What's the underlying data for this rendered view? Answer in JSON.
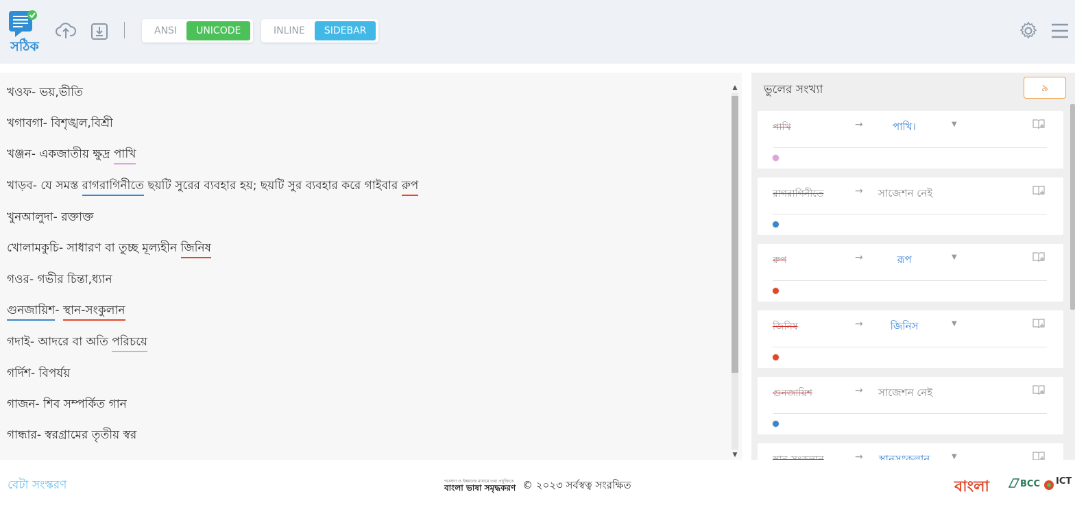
{
  "app": {
    "name": "সঠিক"
  },
  "colors": {
    "accent": "#42b8e6",
    "green": "#4cc15a",
    "error_red": "#e2472a",
    "error_blue": "#3a86c8",
    "error_pink": "#e0a2d8",
    "count_orange": "#e67e22"
  },
  "toolbar": {
    "icons": [
      "upload-cloud-icon",
      "download-icon",
      "settings-icon",
      "hamburger-menu-icon"
    ],
    "encoding": {
      "ansi": "ANSI",
      "unicode": "UNICODE",
      "selected": "UNICODE"
    },
    "view": {
      "inline": "INLINE",
      "sidebar": "SIDEBAR",
      "selected": "SIDEBAR"
    }
  },
  "editor": {
    "lines": [
      [
        "খওফ- ভয়,ভীতি"
      ],
      [
        "খগাবগা- বিশৃঙ্খল,বিশ্রী"
      ],
      [
        "খঞ্জন- একজাতীয় ক্ষুদ্র ",
        "পাখি"
      ],
      [
        "খাড়ব- যে সমস্ত ",
        "রাগরাগিনীতে",
        " ছয়টি সুরের ব্যবহার হয়; ছয়টি সুর ব্যবহার করে গাইবার ",
        "রুপ"
      ],
      [
        "খুনআলুদা- রক্তাক্ত"
      ],
      [
        "খোলামকুচি- সাধারণ বা তুচ্ছ মূল্যহীন ",
        "জিনিষ"
      ],
      [
        "গওর- গভীর চিন্তা,ধ্যান"
      ],
      [
        "গুনজায়িশ",
        "- ",
        "স্থান-সংকুলান"
      ],
      [
        "গদাই- আদরে বা অতি ",
        "পরিচয়ে"
      ],
      [
        "গর্দিশ- বিপর্যয়"
      ],
      [
        "গাজন- শিব সম্পর্কিত গান"
      ],
      [
        "গান্ধার- স্বরগ্রামের তৃতীয় স্বর"
      ]
    ]
  },
  "sidebar": {
    "title": "ভুলের সংখ্যা",
    "error_count": "৯",
    "errors": [
      {
        "original": "পাখি",
        "suggestion": "পাখি।",
        "has_dropdown": true,
        "dot": "#e0a2d8"
      },
      {
        "original": "রাগরাগিনীতে",
        "suggestion": "সাজেশন নেই",
        "has_dropdown": false,
        "dot": "#3a86c8"
      },
      {
        "original": "রুপ",
        "suggestion": "রূপ",
        "has_dropdown": true,
        "dot": "#e2472a"
      },
      {
        "original": "জিনিষ",
        "suggestion": "জিনিস",
        "has_dropdown": true,
        "dot": "#e2472a"
      },
      {
        "original": "গুনজায়িশ",
        "suggestion": "সাজেশন নেই",
        "has_dropdown": false,
        "dot": "#3a86c8"
      },
      {
        "original": "স্থান-সংকুলান",
        "suggestion": "স্থানসংকুলান",
        "has_dropdown": true,
        "dot": "#e2472a"
      }
    ]
  },
  "footer": {
    "beta": "বেটা সংস্করণ",
    "tagline_small": "গবেষণা ও উন্নয়নের মাধ্যমে তথ্য প্রযুক্তিতে",
    "tagline_large": "বাংলা ভাষা সমৃদ্ধকরণ",
    "copyright": "© ২০২৩ সর্বস্বত্ব সংরক্ষিত",
    "logo_bangla": "বাংলা",
    "logo_bcc": "BCC",
    "logo_ict": "ICT"
  }
}
